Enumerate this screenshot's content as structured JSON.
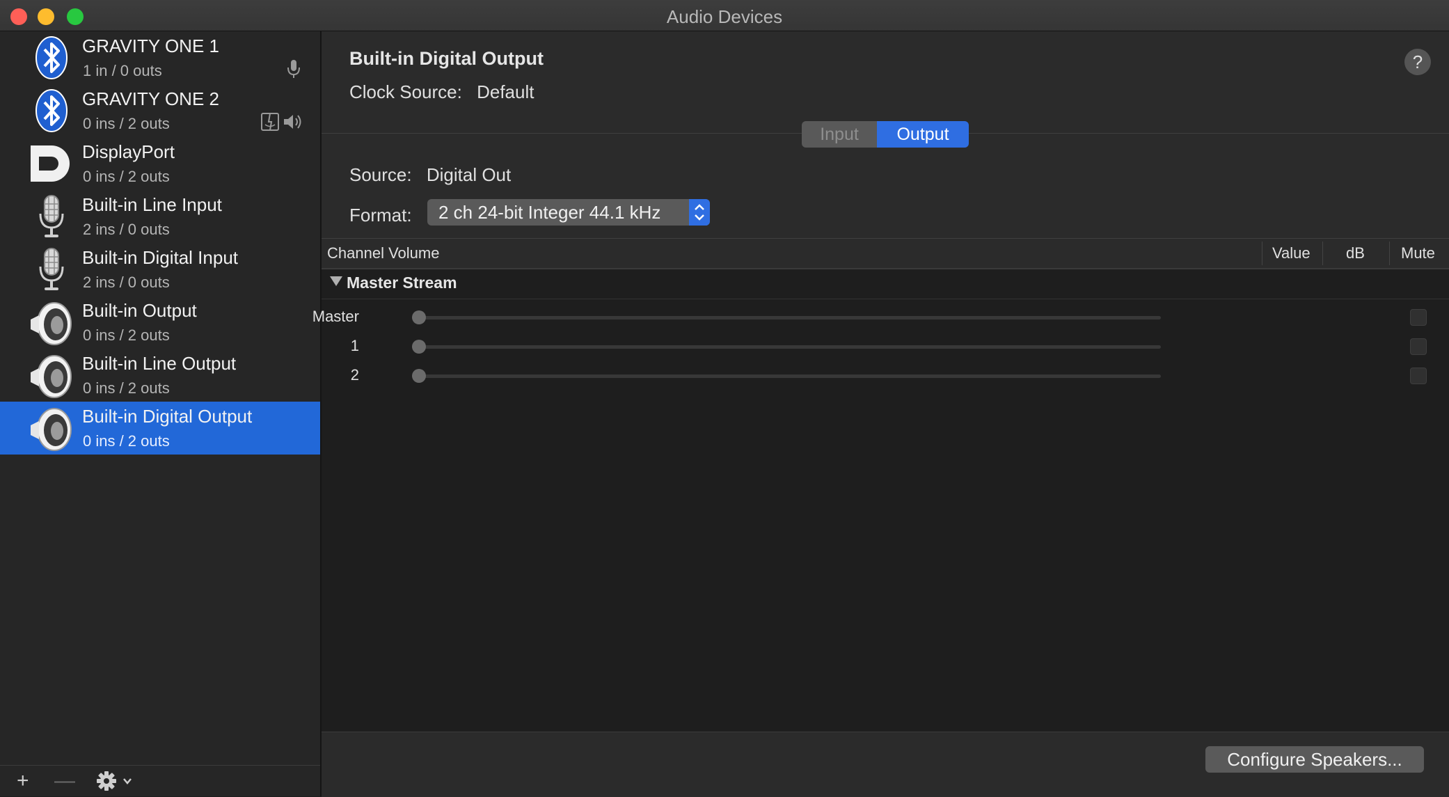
{
  "window": {
    "title": "Audio Devices"
  },
  "sidebar": {
    "devices": [
      {
        "name": "GRAVITY ONE 1",
        "io": "1 in / 0 outs",
        "icon": "bluetooth-icon",
        "badges": [
          "microphone-icon"
        ]
      },
      {
        "name": "GRAVITY ONE 2",
        "io": "0 ins / 2 outs",
        "icon": "bluetooth-icon",
        "badges": [
          "finder-icon",
          "speaker-small-icon"
        ]
      },
      {
        "name": "DisplayPort",
        "io": "0 ins / 2 outs",
        "icon": "displayport-icon"
      },
      {
        "name": "Built-in Line Input",
        "io": "2 ins / 0 outs",
        "icon": "microphone-icon"
      },
      {
        "name": "Built-in Digital Input",
        "io": "2 ins / 0 outs",
        "icon": "microphone-icon"
      },
      {
        "name": "Built-in Output",
        "io": "0 ins / 2 outs",
        "icon": "speaker-icon"
      },
      {
        "name": "Built-in Line Output",
        "io": "0 ins / 2 outs",
        "icon": "speaker-icon"
      },
      {
        "name": "Built-in Digital Output",
        "io": "0 ins / 2 outs",
        "icon": "speaker-icon",
        "selected": true
      }
    ],
    "bottom": {
      "add": "+",
      "remove": "—"
    }
  },
  "detail": {
    "title": "Built-in Digital Output",
    "clock_label": "Clock Source:",
    "clock_value": "Default",
    "help": "?",
    "tabs": {
      "input": "Input",
      "output": "Output",
      "selected": "Output"
    },
    "source_label": "Source:",
    "source_value": "Digital Out",
    "format_label": "Format:",
    "format_value": "2 ch 24-bit Integer 44.1 kHz",
    "table": {
      "headers": {
        "channel_volume": "Channel Volume",
        "value": "Value",
        "db": "dB",
        "mute": "Mute"
      },
      "stream": "Master Stream",
      "channels": [
        {
          "label": "Master",
          "volume": 0,
          "muted": false
        },
        {
          "label": "1",
          "volume": 0,
          "muted": false
        },
        {
          "label": "2",
          "volume": 0,
          "muted": false
        }
      ]
    },
    "configure_button": "Configure Speakers..."
  },
  "colors": {
    "selection": "#2268d8",
    "accent": "#2f6ee2"
  }
}
